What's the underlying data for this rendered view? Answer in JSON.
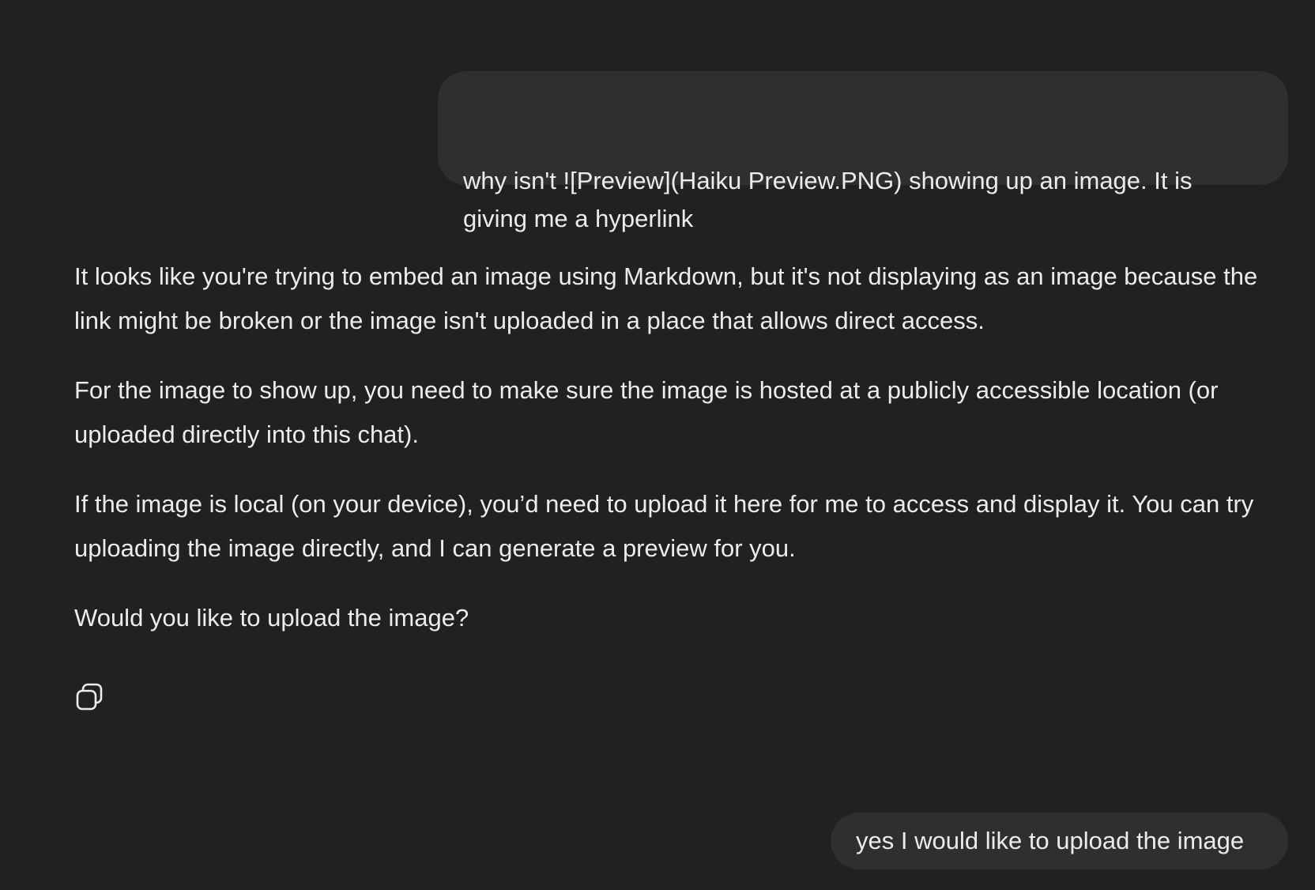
{
  "messages": [
    {
      "role": "user",
      "text": "why isn't ![Preview](Haiku Preview.PNG) showing up an image. It is giving me a hyperlink"
    },
    {
      "role": "assistant",
      "paragraphs": [
        "It looks like you're trying to embed an image using Markdown, but it's not displaying as an image because the link might be broken or the image isn't uploaded in a place that allows direct access.",
        "For the image to show up, you need to make sure the image is hosted at a publicly accessible location (or uploaded directly into this chat).",
        "If the image is local (on your device), you’d need to upload it here for me to access and display it. You can try uploading the image directly, and I can generate a preview for you.",
        "Would you like to upload the image?"
      ],
      "actions": {
        "copy_icon": "copy-icon"
      }
    },
    {
      "role": "user",
      "text": "yes I would like to upload the image"
    }
  ],
  "colors": {
    "background": "#212121",
    "user_bubble": "#2f2f2f",
    "text": "#ececec"
  }
}
